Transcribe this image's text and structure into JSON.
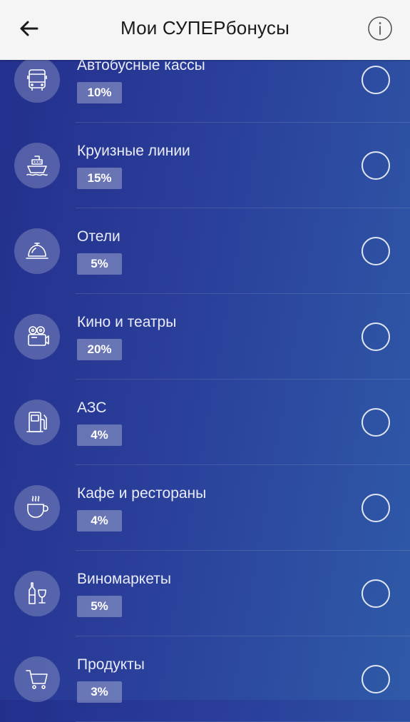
{
  "header": {
    "title": "Мои СУПЕРбонусы",
    "back_icon": "arrow-left-icon",
    "info_icon": "info-icon"
  },
  "categories": [
    {
      "name": "Автобусные кассы",
      "percent": "10%",
      "icon": "bus-icon"
    },
    {
      "name": "Круизные линии",
      "percent": "15%",
      "icon": "ship-icon"
    },
    {
      "name": "Отели",
      "percent": "5%",
      "icon": "bell-icon"
    },
    {
      "name": "Кино и театры",
      "percent": "20%",
      "icon": "film-camera-icon"
    },
    {
      "name": "АЗС",
      "percent": "4%",
      "icon": "fuel-pump-icon"
    },
    {
      "name": "Кафе и рестораны",
      "percent": "4%",
      "icon": "coffee-cup-icon"
    },
    {
      "name": "Виномаркеты",
      "percent": "5%",
      "icon": "wine-icon"
    },
    {
      "name": "Продукты",
      "percent": "3%",
      "icon": "shopping-cart-icon"
    }
  ],
  "colors": {
    "background_start": "#232f8c",
    "background_end": "#2f5aa8",
    "header_bg": "#f5f5f5"
  }
}
